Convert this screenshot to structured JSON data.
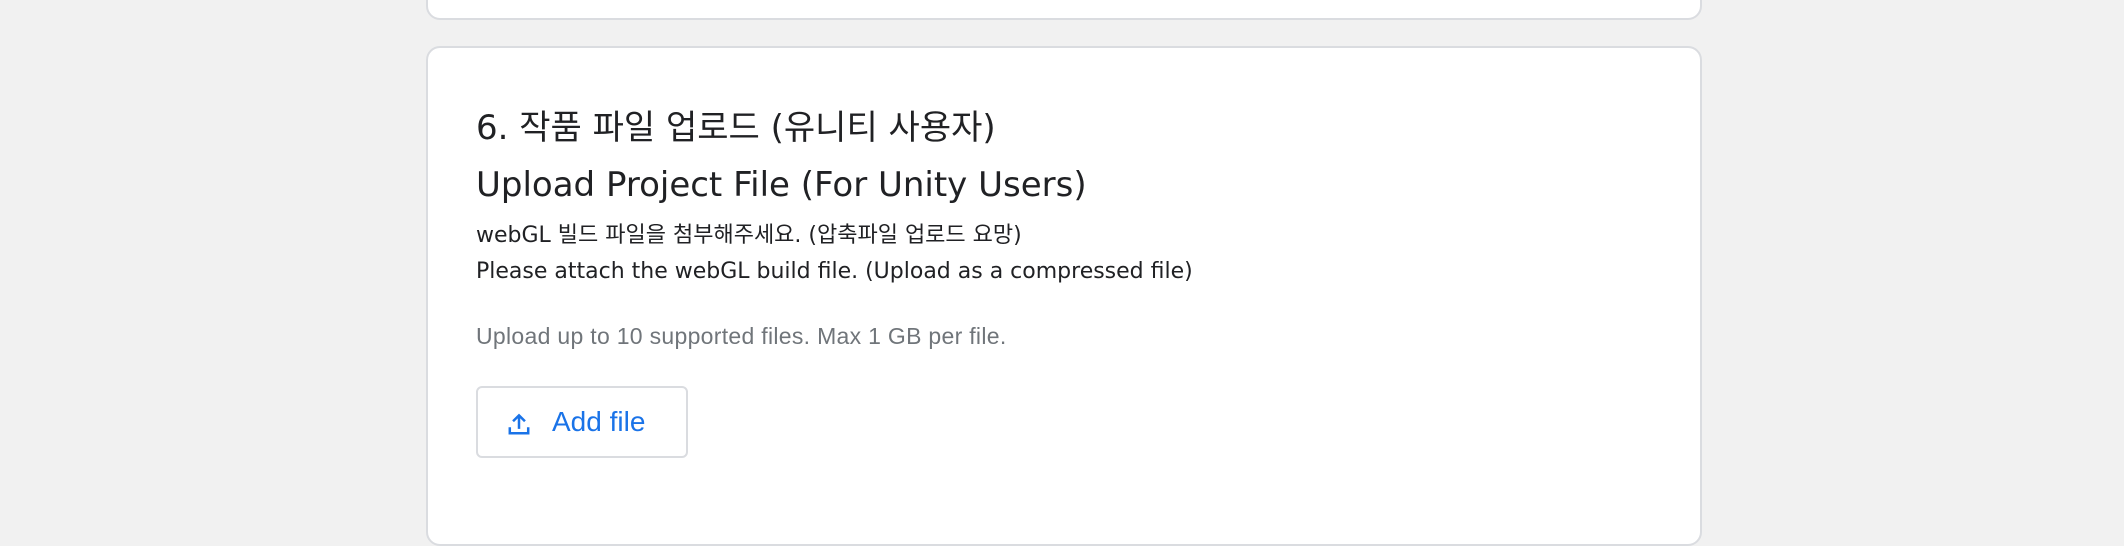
{
  "question": {
    "title_ko": "6. 작품 파일 업로드 (유니티 사용자)",
    "title_en": "Upload Project File (For Unity Users)",
    "description_ko": "webGL 빌드 파일을 첨부해주세요. (압축파일 업로드 요망)",
    "description_en": "Please attach the webGL build file. (Upload as a compressed file)",
    "upload_hint": "Upload up to 10 supported files. Max 1 GB per file.",
    "add_file_label": "Add file",
    "add_file_icon": "upload-icon"
  },
  "colors": {
    "page_background": "#f1f1f1",
    "card_background": "#ffffff",
    "card_border": "#dadce0",
    "text_primary": "#202124",
    "text_secondary": "#70757a",
    "accent": "#1a73e8"
  }
}
